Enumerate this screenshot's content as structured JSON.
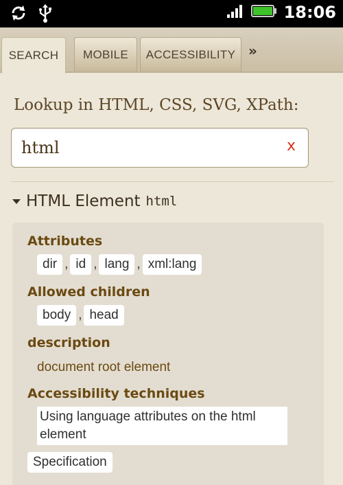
{
  "status_bar": {
    "time": "18:06",
    "icons": [
      "sync-icon",
      "usb-icon",
      "signal-icon",
      "battery-icon"
    ]
  },
  "tabs": [
    {
      "label": "SEARCH",
      "active": true
    },
    {
      "label": "MOBILE",
      "active": false
    },
    {
      "label": "ACCESSIBILITY",
      "active": false
    }
  ],
  "more_tabs_label": "»",
  "search": {
    "label": "Lookup in HTML, CSS, SVG, XPath:",
    "value": "html",
    "clear_label": "x"
  },
  "result": {
    "heading": "HTML Element",
    "code": "html",
    "attributes_title": "Attributes",
    "attributes": [
      "dir",
      "id",
      "lang",
      "xml:lang"
    ],
    "children_title": "Allowed children",
    "children": [
      "body",
      "head"
    ],
    "description_title": "description",
    "description": "document root element",
    "techniques_title": "Accessibility techniques",
    "technique": "Using language attributes on the html element",
    "spec_label": "Specification",
    "separator": ","
  },
  "colors": {
    "accent": "#6b4a12",
    "clear": "#d8341e",
    "battery": "#3ec42a"
  }
}
